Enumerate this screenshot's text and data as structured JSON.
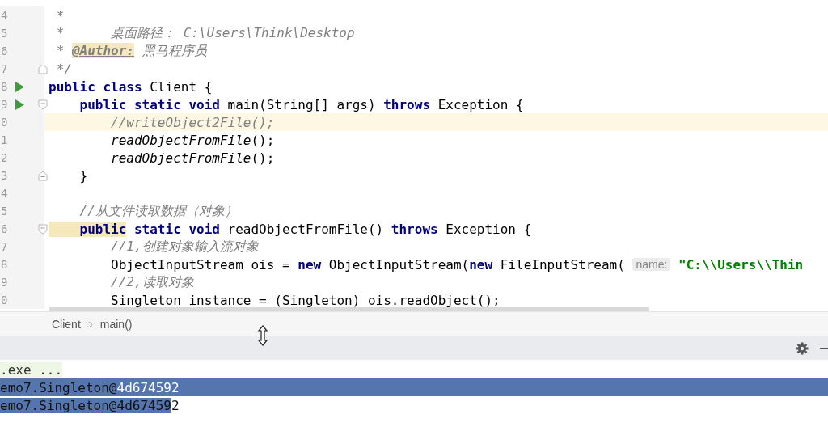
{
  "editor": {
    "lines": [
      {
        "number": "4",
        "current": false,
        "run": false,
        "fold_start": false,
        "fold_end": false,
        "segments": [
          {
            "kind": "comment",
            "text": " *"
          }
        ]
      },
      {
        "number": "5",
        "current": false,
        "run": false,
        "fold_start": false,
        "fold_end": false,
        "segments": [
          {
            "kind": "comment",
            "text": " *      桌面路径： C:\\Users\\Think\\Desktop"
          }
        ]
      },
      {
        "number": "6",
        "current": false,
        "run": false,
        "fold_start": false,
        "fold_end": false,
        "segments": [
          {
            "kind": "comment",
            "text": " * "
          },
          {
            "kind": "marked-annotation",
            "text": "@Author:"
          },
          {
            "kind": "comment",
            "text": " 黑马程序员"
          }
        ]
      },
      {
        "number": "7",
        "current": false,
        "run": false,
        "fold_start": false,
        "fold_end": true,
        "segments": [
          {
            "kind": "comment",
            "text": " */"
          }
        ]
      },
      {
        "number": "8",
        "current": false,
        "run": true,
        "fold_start": false,
        "fold_end": false,
        "segments": [
          {
            "kind": "keyword",
            "text": "public class"
          },
          {
            "kind": "plain",
            "text": " Client {"
          }
        ]
      },
      {
        "number": "9",
        "current": false,
        "run": true,
        "fold_start": true,
        "fold_end": false,
        "segments": [
          {
            "kind": "keyword",
            "text": "    public static void"
          },
          {
            "kind": "plain",
            "text": " main(String[] args) "
          },
          {
            "kind": "keyword",
            "text": "throws"
          },
          {
            "kind": "plain",
            "text": " Exception {"
          }
        ]
      },
      {
        "number": "0",
        "current": true,
        "run": false,
        "fold_start": false,
        "fold_end": false,
        "segments": [
          {
            "kind": "comment",
            "text": "        //writeObject2File();"
          }
        ]
      },
      {
        "number": "1",
        "current": false,
        "run": false,
        "fold_start": false,
        "fold_end": false,
        "segments": [
          {
            "kind": "static-call",
            "text": "        readObjectFromFile"
          },
          {
            "kind": "plain",
            "text": "();"
          }
        ]
      },
      {
        "number": "2",
        "current": false,
        "run": false,
        "fold_start": false,
        "fold_end": false,
        "segments": [
          {
            "kind": "static-call",
            "text": "        readObjectFromFile"
          },
          {
            "kind": "plain",
            "text": "();"
          }
        ]
      },
      {
        "number": "3",
        "current": false,
        "run": false,
        "fold_start": false,
        "fold_end": true,
        "segments": [
          {
            "kind": "plain",
            "text": "    }"
          }
        ]
      },
      {
        "number": "4",
        "current": false,
        "run": false,
        "fold_start": false,
        "fold_end": false
      },
      {
        "number": "5",
        "current": false,
        "run": false,
        "fold_start": false,
        "fold_end": false,
        "segments": [
          {
            "kind": "comment",
            "text": "    //从文件读取数据（对象）"
          }
        ]
      },
      {
        "number": "6",
        "current": false,
        "run": false,
        "fold_start": true,
        "fold_end": false,
        "segments": [
          {
            "kind": "marked-keyword",
            "text": "    public"
          },
          {
            "kind": "keyword",
            "text": " static void"
          },
          {
            "kind": "plain",
            "text": " readObjectFromFile() "
          },
          {
            "kind": "keyword",
            "text": "throws"
          },
          {
            "kind": "plain",
            "text": " Exception {"
          }
        ]
      },
      {
        "number": "7",
        "current": false,
        "run": false,
        "fold_start": false,
        "fold_end": false,
        "segments": [
          {
            "kind": "comment",
            "text": "        //1,创建对象输入流对象"
          }
        ]
      },
      {
        "number": "8",
        "current": false,
        "run": false,
        "fold_start": false,
        "fold_end": false,
        "segments": [
          {
            "kind": "plain",
            "text": "        ObjectInputStream ois = "
          },
          {
            "kind": "keyword",
            "text": "new"
          },
          {
            "kind": "plain",
            "text": " ObjectInputStream("
          },
          {
            "kind": "keyword",
            "text": "new"
          },
          {
            "kind": "plain",
            "text": " FileInputStream( "
          },
          {
            "kind": "hint",
            "text": "name:"
          },
          {
            "kind": "string",
            "text": " \"C:\\\\Users\\\\Thin"
          }
        ]
      },
      {
        "number": "9",
        "current": false,
        "run": false,
        "fold_start": false,
        "fold_end": false,
        "segments": [
          {
            "kind": "comment",
            "text": "        //2,读取对象"
          }
        ]
      },
      {
        "number": "0",
        "current": false,
        "run": false,
        "fold_start": false,
        "fold_end": false,
        "segments": [
          {
            "kind": "plain",
            "text": "        Singleton instance = (Singleton) ois.readObject();"
          }
        ]
      }
    ]
  },
  "breadcrumb": [
    "Client",
    "main()"
  ],
  "console": {
    "lines": [
      {
        "kind": "info",
        "selected": false,
        "segments": [
          {
            "text": ".exe ...",
            "selected": false,
            "bright": false
          }
        ]
      },
      {
        "kind": "output",
        "selected": true,
        "segments": [
          {
            "text": "emo7.Singleton@",
            "selected": true,
            "bright": false
          },
          {
            "text": "4d674592",
            "selected": true,
            "bright": true
          }
        ]
      },
      {
        "kind": "output",
        "selected": false,
        "segments": [
          {
            "text": "emo7.Singleton@4d67459",
            "selected": true,
            "bright": false
          },
          {
            "text": "2",
            "selected": false,
            "bright": false
          }
        ]
      }
    ]
  }
}
